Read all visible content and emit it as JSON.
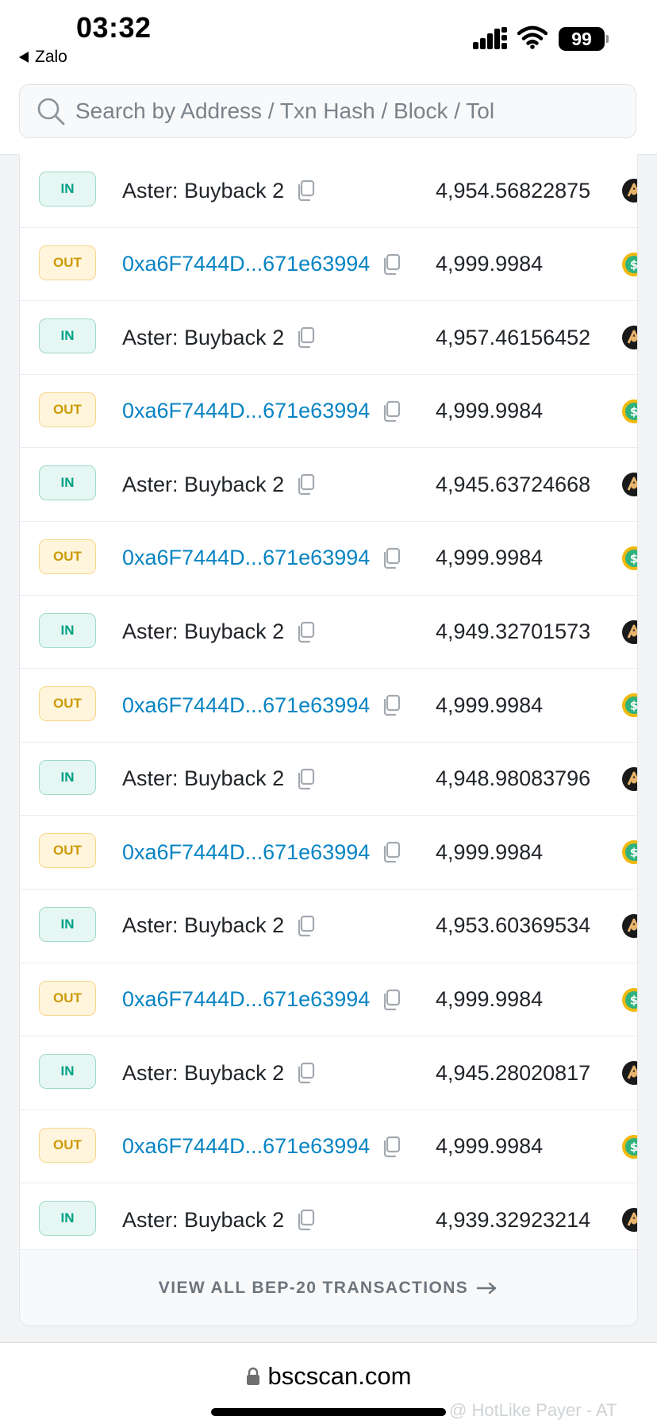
{
  "status_bar": {
    "time": "03:32",
    "back_app": "Zalo",
    "battery": "99"
  },
  "search": {
    "placeholder": "Search by Address / Txn Hash / Block / Tol"
  },
  "colors": {
    "link_blue": "#0784c3",
    "in_green": "#00a186",
    "out_amber": "#cc9a06"
  },
  "transfers": [
    {
      "direction": "IN",
      "party": "Aster: Buyback 2",
      "amount": "4,954.56822875",
      "token_icon": "aster-token-icon"
    },
    {
      "direction": "OUT",
      "party": "0xa6F7444D...671e63994",
      "amount": "4,999.9984",
      "token_icon": "usd-token-icon"
    },
    {
      "direction": "IN",
      "party": "Aster: Buyback 2",
      "amount": "4,957.46156452",
      "token_icon": "aster-token-icon"
    },
    {
      "direction": "OUT",
      "party": "0xa6F7444D...671e63994",
      "amount": "4,999.9984",
      "token_icon": "usd-token-icon"
    },
    {
      "direction": "IN",
      "party": "Aster: Buyback 2",
      "amount": "4,945.63724668",
      "token_icon": "aster-token-icon"
    },
    {
      "direction": "OUT",
      "party": "0xa6F7444D...671e63994",
      "amount": "4,999.9984",
      "token_icon": "usd-token-icon"
    },
    {
      "direction": "IN",
      "party": "Aster: Buyback 2",
      "amount": "4,949.32701573",
      "token_icon": "aster-token-icon"
    },
    {
      "direction": "OUT",
      "party": "0xa6F7444D...671e63994",
      "amount": "4,999.9984",
      "token_icon": "usd-token-icon"
    },
    {
      "direction": "IN",
      "party": "Aster: Buyback 2",
      "amount": "4,948.98083796",
      "token_icon": "aster-token-icon"
    },
    {
      "direction": "OUT",
      "party": "0xa6F7444D...671e63994",
      "amount": "4,999.9984",
      "token_icon": "usd-token-icon"
    },
    {
      "direction": "IN",
      "party": "Aster: Buyback 2",
      "amount": "4,953.60369534",
      "token_icon": "aster-token-icon"
    },
    {
      "direction": "OUT",
      "party": "0xa6F7444D...671e63994",
      "amount": "4,999.9984",
      "token_icon": "usd-token-icon"
    },
    {
      "direction": "IN",
      "party": "Aster: Buyback 2",
      "amount": "4,945.28020817",
      "token_icon": "aster-token-icon"
    },
    {
      "direction": "OUT",
      "party": "0xa6F7444D...671e63994",
      "amount": "4,999.9984",
      "token_icon": "usd-token-icon"
    },
    {
      "direction": "IN",
      "party": "Aster: Buyback 2",
      "amount": "4,939.32923214",
      "token_icon": "aster-token-icon"
    }
  ],
  "view_all_label": "VIEW ALL BEP-20 TRANSACTIONS",
  "browser": {
    "url": "bscscan.com"
  },
  "watermark": "@ HotLike Payer - AT"
}
